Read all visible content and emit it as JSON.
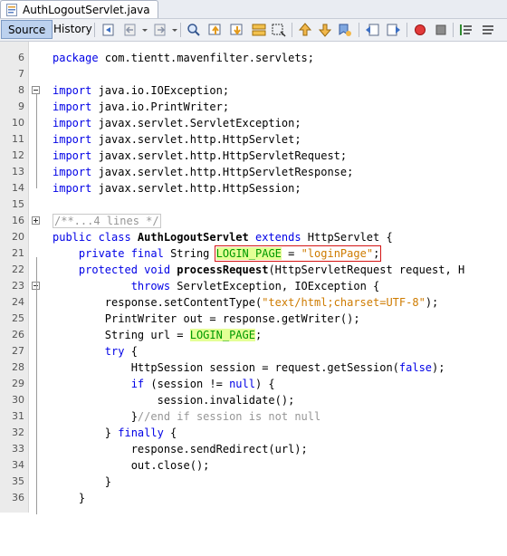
{
  "tab": {
    "title": "AuthLogoutServlet.java"
  },
  "toolbar": {
    "source_label": "Source",
    "history_label": "History",
    "buttons": [
      "last-edit-icon",
      "back-icon",
      "forward-icon",
      "find-icon",
      "find-prev-icon",
      "find-next-icon",
      "toggle-highlight-icon",
      "toggle-rect-select-icon",
      "prev-bookmark-icon",
      "next-bookmark-icon",
      "toggle-bookmark-icon",
      "shift-left-icon",
      "shift-right-icon",
      "start-macro-icon",
      "stop-macro-icon",
      "comment-icon",
      "uncomment-icon"
    ]
  },
  "colors": {
    "keyword": "#0000e6",
    "string": "#ce7b00",
    "comment": "#969696",
    "field": "#009900",
    "field_bg": "#e4ff96",
    "highlight_box": "#d51515"
  },
  "lines": [
    {
      "n": "6",
      "t": [
        {
          "c": "kw",
          "s": "package"
        },
        {
          "c": "",
          "s": " com.tientt.mavenfilter.servlets;"
        }
      ]
    },
    {
      "n": "7",
      "t": []
    },
    {
      "n": "8",
      "t": [
        {
          "c": "kw",
          "s": "import"
        },
        {
          "c": "",
          "s": " java.io.IOException;"
        }
      ]
    },
    {
      "n": "9",
      "t": [
        {
          "c": "kw",
          "s": "import"
        },
        {
          "c": "",
          "s": " java.io.PrintWriter;"
        }
      ]
    },
    {
      "n": "10",
      "t": [
        {
          "c": "kw",
          "s": "import"
        },
        {
          "c": "",
          "s": " javax.servlet.ServletException;"
        }
      ]
    },
    {
      "n": "11",
      "t": [
        {
          "c": "kw",
          "s": "import"
        },
        {
          "c": "",
          "s": " javax.servlet.http.HttpServlet;"
        }
      ]
    },
    {
      "n": "12",
      "t": [
        {
          "c": "kw",
          "s": "import"
        },
        {
          "c": "",
          "s": " javax.servlet.http.HttpServletRequest;"
        }
      ]
    },
    {
      "n": "13",
      "t": [
        {
          "c": "kw",
          "s": "import"
        },
        {
          "c": "",
          "s": " javax.servlet.http.HttpServletResponse;"
        }
      ]
    },
    {
      "n": "14",
      "t": [
        {
          "c": "kw",
          "s": "import"
        },
        {
          "c": "",
          "s": " javax.servlet.http.HttpSession;"
        }
      ]
    },
    {
      "n": "15",
      "t": []
    },
    {
      "n": "16",
      "t": [
        {
          "c": "collapsed",
          "s": "/**...4 lines */"
        }
      ]
    },
    {
      "n": "20",
      "t": [
        {
          "c": "kw",
          "s": "public class "
        },
        {
          "c": "fn",
          "s": "AuthLogoutServlet"
        },
        {
          "c": "kw",
          "s": " extends "
        },
        {
          "c": "",
          "s": "HttpServlet {"
        }
      ]
    },
    {
      "n": "21",
      "t": [
        {
          "c": "",
          "s": "    "
        },
        {
          "c": "kw",
          "s": "private final "
        },
        {
          "c": "",
          "s": "String "
        },
        {
          "c": "box-start",
          "s": ""
        },
        {
          "c": "fld",
          "s": "LOGIN_PAGE"
        },
        {
          "c": "",
          "s": " = "
        },
        {
          "c": "str",
          "s": "\"loginPage\""
        },
        {
          "c": "",
          "s": ";"
        },
        {
          "c": "box-end",
          "s": ""
        }
      ]
    },
    {
      "n": "22",
      "t": [
        {
          "c": "",
          "s": "    "
        },
        {
          "c": "kw",
          "s": "protected void "
        },
        {
          "c": "fn",
          "s": "processRequest"
        },
        {
          "c": "",
          "s": "(HttpServletRequest request, H"
        }
      ]
    },
    {
      "n": "23",
      "t": [
        {
          "c": "",
          "s": "            "
        },
        {
          "c": "kw",
          "s": "throws"
        },
        {
          "c": "",
          "s": " ServletException, IOException {"
        }
      ]
    },
    {
      "n": "24",
      "t": [
        {
          "c": "",
          "s": "        response.setContentType("
        },
        {
          "c": "str",
          "s": "\"text/html;charset=UTF-8\""
        },
        {
          "c": "",
          "s": ");"
        }
      ]
    },
    {
      "n": "25",
      "t": [
        {
          "c": "",
          "s": "        PrintWriter out = response.getWriter();"
        }
      ]
    },
    {
      "n": "26",
      "t": [
        {
          "c": "",
          "s": "        String url = "
        },
        {
          "c": "fld",
          "s": "LOGIN_PAGE"
        },
        {
          "c": "",
          "s": ";"
        }
      ]
    },
    {
      "n": "27",
      "t": [
        {
          "c": "",
          "s": "        "
        },
        {
          "c": "kw",
          "s": "try"
        },
        {
          "c": "",
          "s": " {"
        }
      ]
    },
    {
      "n": "28",
      "t": [
        {
          "c": "",
          "s": "            HttpSession session = request.getSession("
        },
        {
          "c": "kw",
          "s": "false"
        },
        {
          "c": "",
          "s": ");"
        }
      ]
    },
    {
      "n": "29",
      "t": [
        {
          "c": "",
          "s": "            "
        },
        {
          "c": "kw",
          "s": "if"
        },
        {
          "c": "",
          "s": " (session != "
        },
        {
          "c": "kw",
          "s": "null"
        },
        {
          "c": "",
          "s": ") {"
        }
      ]
    },
    {
      "n": "30",
      "t": [
        {
          "c": "",
          "s": "                session.invalidate();"
        }
      ]
    },
    {
      "n": "31",
      "t": [
        {
          "c": "",
          "s": "            }"
        },
        {
          "c": "cmt",
          "s": "//end if session is not null"
        }
      ]
    },
    {
      "n": "32",
      "t": [
        {
          "c": "",
          "s": "        } "
        },
        {
          "c": "kw",
          "s": "finally"
        },
        {
          "c": "",
          "s": " {"
        }
      ]
    },
    {
      "n": "33",
      "t": [
        {
          "c": "",
          "s": "            response.sendRedirect(url);"
        }
      ]
    },
    {
      "n": "34",
      "t": [
        {
          "c": "",
          "s": "            out.close();"
        }
      ]
    },
    {
      "n": "35",
      "t": [
        {
          "c": "",
          "s": "        }"
        }
      ]
    },
    {
      "n": "36",
      "t": [
        {
          "c": "",
          "s": "    }"
        }
      ]
    }
  ]
}
